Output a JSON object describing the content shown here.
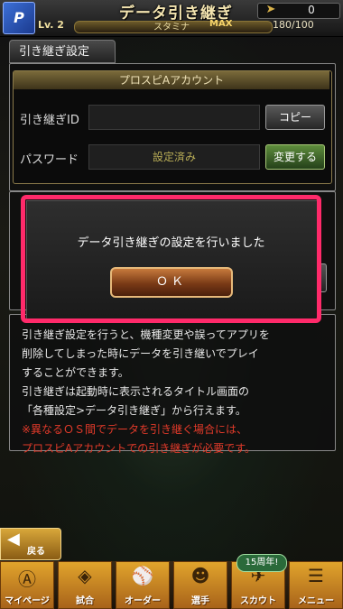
{
  "header": {
    "title": "データ引き継ぎ",
    "level": "Lv. 2",
    "stamina_label": "スタミナ",
    "stamina_max_badge": "MAX",
    "stamina_value": "180/100",
    "coins": "0",
    "logo": "P"
  },
  "section": {
    "tab_label": "引き継ぎ設定"
  },
  "account": {
    "header": "プロスピAアカウント",
    "id_label": "引き継ぎID",
    "id_value": "",
    "copy_button": "コピー",
    "password_label": "パスワード",
    "password_value": "設定済み",
    "change_button": "変更する"
  },
  "info": {
    "lines": [
      "引き継ぎ設定を行うと、機種変更や誤ってアプリを",
      "削除してしまった時にデータを引き継いでプレイ",
      "することができます。",
      "引き継ぎは起動時に表示されるタイトル画面の",
      "「各種設定>データ引き継ぎ」から行えます。"
    ],
    "warning_lines": [
      "※異なるＯＳ間でデータを引き継ぐ場合には、",
      "プロスピAアカウントでの引き継ぎが必要です。"
    ]
  },
  "dialog": {
    "message": "データ引き継ぎの設定を行いました",
    "ok_button": "ＯＫ"
  },
  "back_button": "戻る",
  "bottom_nav": {
    "items": [
      "マイページ",
      "試合",
      "オーダー",
      "選手",
      "スカウト",
      "メニュー"
    ],
    "badge": "15周年!"
  }
}
